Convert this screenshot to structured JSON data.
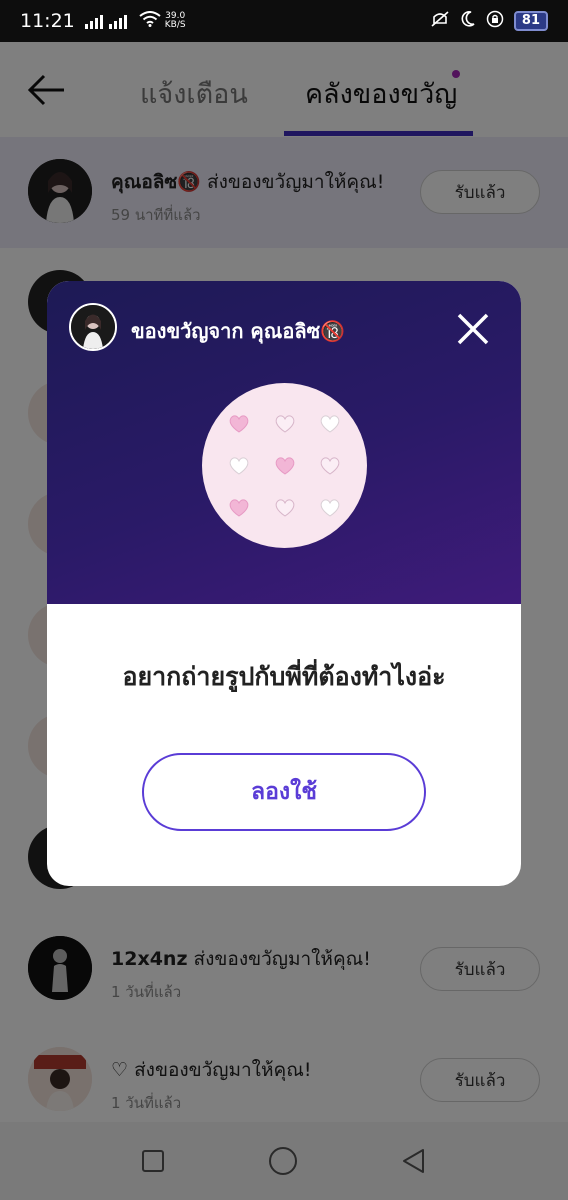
{
  "status_bar": {
    "time": "11:21",
    "speed_value": "39.0",
    "speed_unit": "KB/S",
    "battery": "81"
  },
  "header": {
    "tabs": [
      {
        "label": "แจ้งเตือน",
        "active": false
      },
      {
        "label": "คลังของขวัญ",
        "active": true
      }
    ]
  },
  "list": {
    "items": [
      {
        "sender": "คุณอลิซ🔞",
        "message": " ส่งของขวัญมาให้คุณ!",
        "time": "59 นาทีที่แล้ว",
        "button": "รับแล้ว"
      },
      {
        "sender": "12x4nz",
        "message": " ส่งของขวัญมาให้คุณ!",
        "time": "1 วันที่แล้ว",
        "button": "รับแล้ว"
      },
      {
        "sender": "♡",
        "message": " ส่งของขวัญมาให้คุณ!",
        "time": "1 วันที่แล้ว",
        "button": "รับแล้ว"
      }
    ]
  },
  "modal": {
    "title": "ของขวัญจาก คุณอลิซ🔞",
    "message": "อยากถ่ายรูปกับพี่ที่ต้องทำไงอ่ะ",
    "button": "ลองใช้"
  },
  "colors": {
    "accent": "#5a3cd6",
    "tab_underline": "#3f2dbf",
    "modal_gradient_start": "#1d1a55",
    "modal_gradient_end": "#3f1b7a",
    "gift_circle": "#f9e6ef"
  },
  "icons": [
    "back-arrow-icon",
    "close-icon",
    "heart-icon",
    "square-nav-icon",
    "circle-nav-icon",
    "triangle-nav-icon"
  ]
}
